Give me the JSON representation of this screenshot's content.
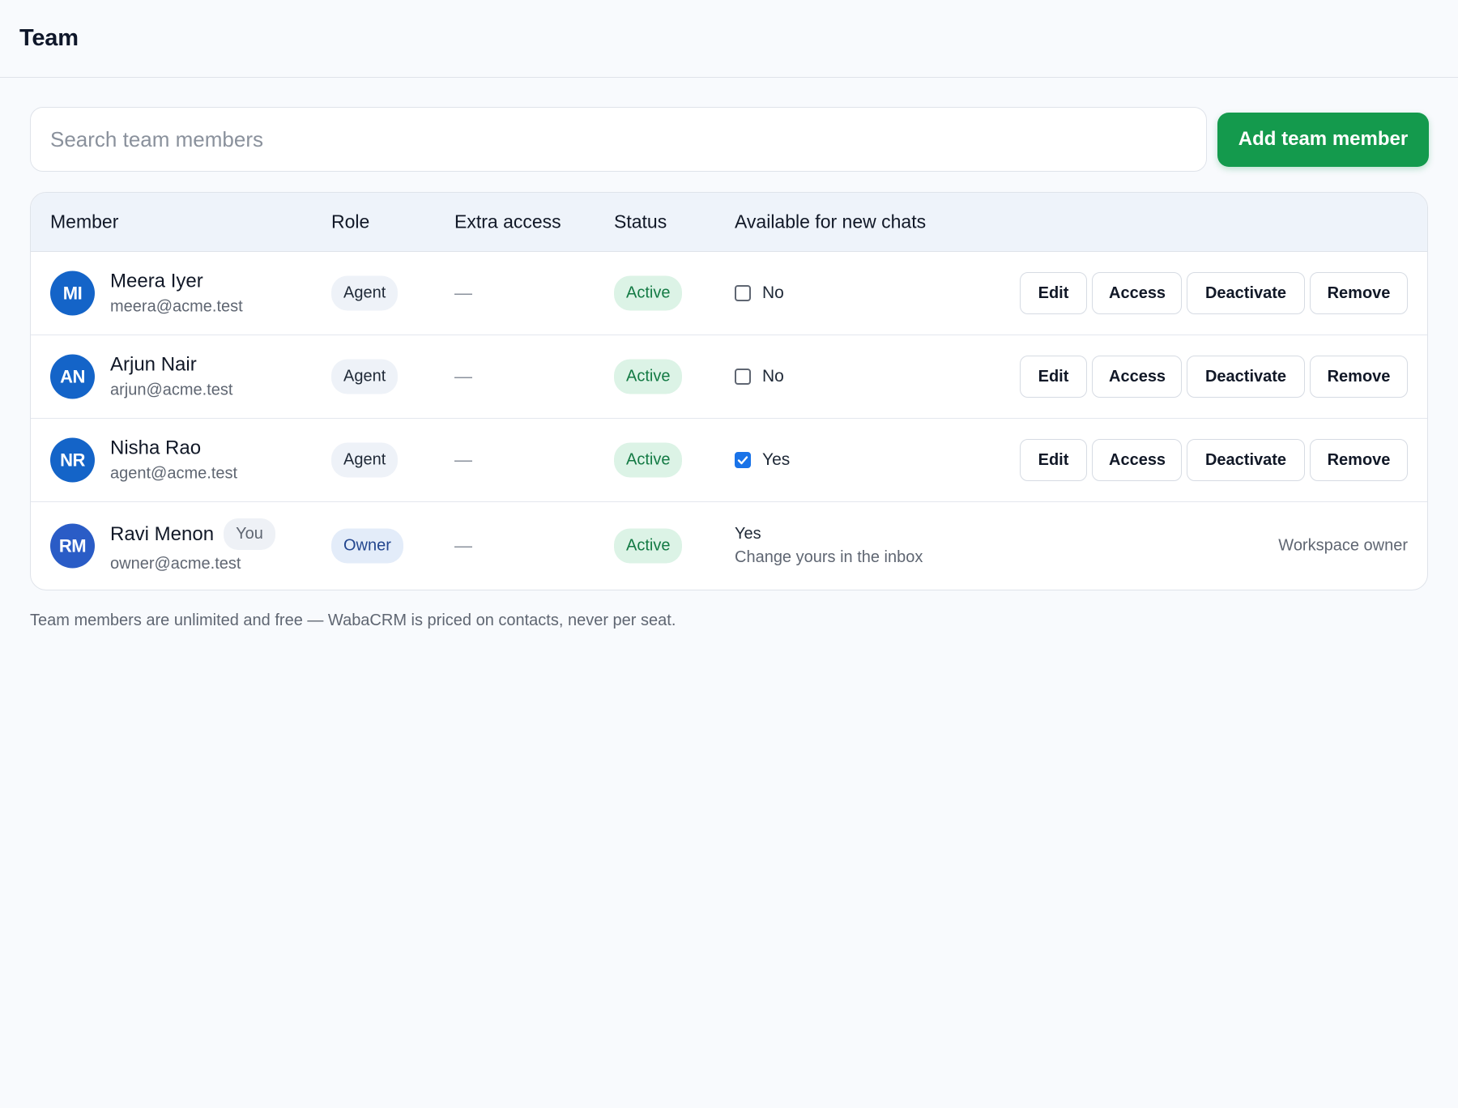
{
  "header": {
    "title": "Team"
  },
  "toolbar": {
    "search_placeholder": "Search team members",
    "search_value": "",
    "add_label": "Add team member"
  },
  "table": {
    "columns": {
      "member": "Member",
      "role": "Role",
      "extra_access": "Extra access",
      "status": "Status",
      "available": "Available for new chats"
    },
    "rows": [
      {
        "initials": "MI",
        "name": "Meera Iyer",
        "email": "meera@acme.test",
        "role": "Agent",
        "extra": "—",
        "status": "Active",
        "available": "No",
        "available_checked": false,
        "actions": {
          "edit": "Edit",
          "access": "Access",
          "deactivate": "Deactivate",
          "remove": "Remove"
        }
      },
      {
        "initials": "AN",
        "name": "Arjun Nair",
        "email": "arjun@acme.test",
        "role": "Agent",
        "extra": "—",
        "status": "Active",
        "available": "No",
        "available_checked": false,
        "actions": {
          "edit": "Edit",
          "access": "Access",
          "deactivate": "Deactivate",
          "remove": "Remove"
        }
      },
      {
        "initials": "NR",
        "name": "Nisha Rao",
        "email": "agent@acme.test",
        "role": "Agent",
        "extra": "—",
        "status": "Active",
        "available": "Yes",
        "available_checked": true,
        "actions": {
          "edit": "Edit",
          "access": "Access",
          "deactivate": "Deactivate",
          "remove": "Remove"
        }
      },
      {
        "initials": "RM",
        "name": "Ravi Menon",
        "you_badge": "You",
        "email": "owner@acme.test",
        "role": "Owner",
        "extra": "—",
        "status": "Active",
        "available": "Yes",
        "available_hint": "Change yours in the inbox",
        "owner_note": "Workspace owner"
      }
    ]
  },
  "footnote": "Team members are unlimited and free — WabaCRM is priced on contacts, never per seat.",
  "colors": {
    "primary_green": "#149a4d",
    "avatar_blue": "#1464c8",
    "status_green_bg": "#dcf3e6",
    "status_green_text": "#137a44",
    "checkbox_blue": "#1a73e8"
  }
}
